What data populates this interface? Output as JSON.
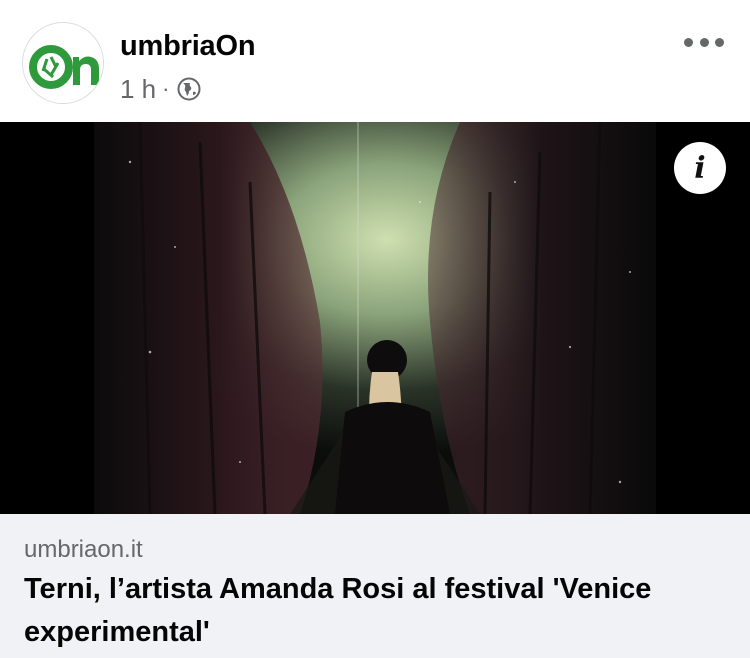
{
  "post": {
    "page_name": "umbriaOn",
    "time_ago": "1 h",
    "separator": "·",
    "audience_icon": "globe-icon",
    "more_icon": "more-dots-icon"
  },
  "media": {
    "info_label": "i",
    "info_icon": "info-icon"
  },
  "link_preview": {
    "domain": "umbriaon.it",
    "title": "Terni, l’artista Amanda Rosi al festival 'Venice experimental'"
  },
  "colors": {
    "brand_green": "#2e9a3c",
    "secondary_text": "#65676b",
    "card_background": "#f0f2f5"
  }
}
